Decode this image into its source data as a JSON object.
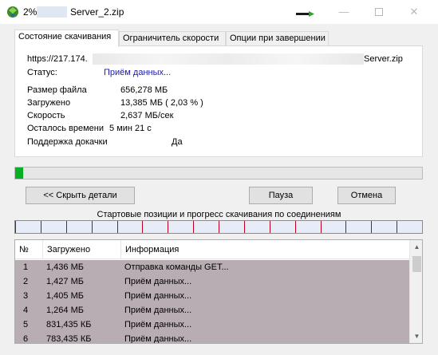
{
  "window": {
    "title_percent": "2%",
    "title_filename": "Server_2.zip",
    "min_glyph": "—",
    "close_glyph": "✕"
  },
  "tabs": [
    {
      "label": "Состояние скачивания",
      "active": true
    },
    {
      "label": "Ограничитель скорости",
      "active": false
    },
    {
      "label": "Опции при завершении",
      "active": false
    }
  ],
  "details": {
    "url_prefix": "https://217.174.",
    "url_suffix": "Server.zip",
    "status_label": "Статус:",
    "status_value": "Приём данных...",
    "rows": [
      {
        "label": "Размер файла",
        "value": "656,278  МБ"
      },
      {
        "label": "Загружено",
        "value": "13,385  МБ  ( 2,03 % )"
      },
      {
        "label": "Скорость",
        "value": "2,637  МБ/сек"
      },
      {
        "label": "Осталось времени",
        "value": "5 мин 21 с"
      },
      {
        "label": "Поддержка докачки",
        "value": "Да"
      }
    ]
  },
  "progress": {
    "percent": 2.03,
    "color": "#06b025"
  },
  "buttons": {
    "hide_details": "<< Скрыть детали",
    "pause": "Пауза",
    "cancel": "Отмена"
  },
  "connections": {
    "title": "Стартовые позиции и прогресс скачивания по соединениям",
    "count": 16
  },
  "table": {
    "headers": {
      "num": "№",
      "downloaded": "Загружено",
      "info": "Информация"
    },
    "rows": [
      {
        "num": "1",
        "downloaded": "1,436  МБ",
        "info": "Отправка команды GET..."
      },
      {
        "num": "2",
        "downloaded": "1,427  МБ",
        "info": "Приём данных..."
      },
      {
        "num": "3",
        "downloaded": "1,405  МБ",
        "info": "Приём данных..."
      },
      {
        "num": "4",
        "downloaded": "1,264  МБ",
        "info": "Приём данных..."
      },
      {
        "num": "5",
        "downloaded": "831,435  КБ",
        "info": "Приём данных..."
      },
      {
        "num": "6",
        "downloaded": "783,435  КБ",
        "info": "Приём данных..."
      }
    ],
    "selected_row_color": "#b9adb4"
  }
}
